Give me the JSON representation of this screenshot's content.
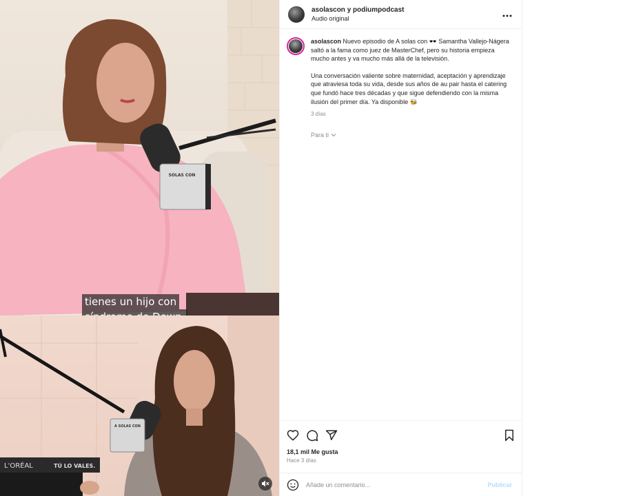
{
  "video": {
    "subtitle_lines": [
      "tienes un hijo con",
      "síndrome de Down,"
    ],
    "mic_label_top": "SOLAS CON",
    "mic_label_bottom": "A SOLAS CON",
    "shelf_brand": "L'ORÉAL",
    "shelf_book": "TÚ LO VALES.",
    "mute_icon": "speaker-muted-icon"
  },
  "post": {
    "header": {
      "authors": "asolascon y podiumpodcast",
      "audio": "Audio original",
      "more_icon": "more-dots-icon"
    },
    "caption": {
      "username": "asolascon",
      "text_1": "Nuevo episodio de A solas con 🕶️ Samantha Vallejo-Nágera saltó a la fama como juez de MasterChef, pero su historia empieza mucho antes y va mucho más allá de la televisión.",
      "text_2": "Una conversación valiente sobre maternidad, aceptación y aprendizaje que atraviesa toda su vida, desde sus años de au pair hasta el catering que fundó hace tres décadas y que sigue defendiendo con la misma ilusión del primer día. Ya disponible 🐝",
      "time": "3 días"
    },
    "for_you": "Para ti",
    "likes": "18,1 mil Me gusta",
    "posted": "Hace 3 días",
    "comment": {
      "placeholder": "Añade un comentario...",
      "publish": "Publicar"
    }
  },
  "colors": {
    "accent_blue": "#0095f6",
    "publish_disabled": "#b2dffc",
    "story_ring": "#d6249f",
    "secondary_text": "#8e8e8e"
  }
}
